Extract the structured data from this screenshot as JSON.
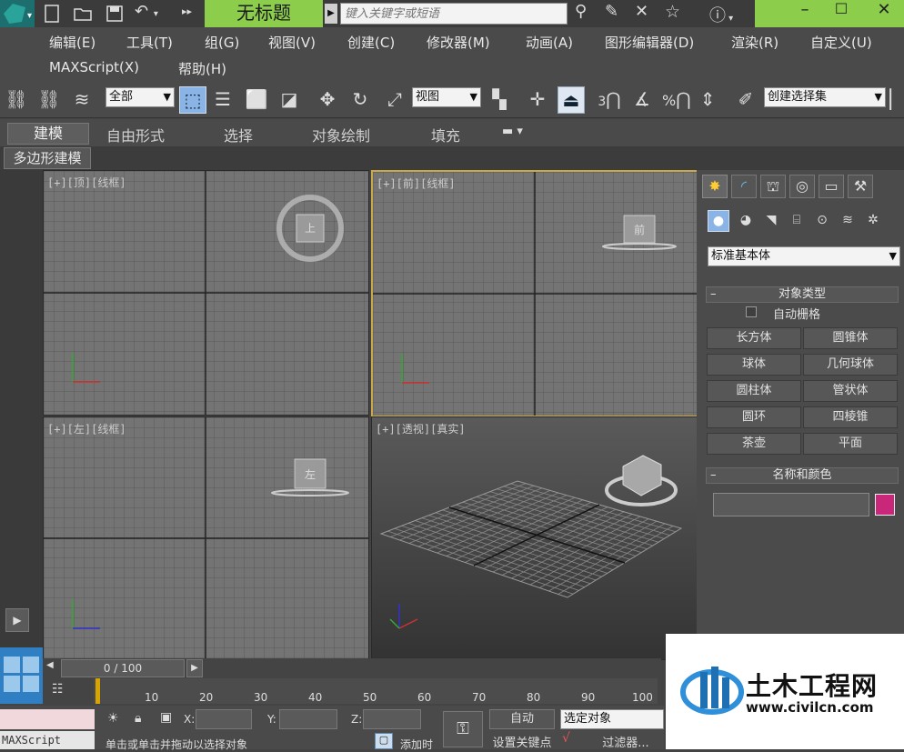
{
  "window": {
    "title": "无标题",
    "search_placeholder": "键入关键字或短语"
  },
  "menu": [
    {
      "label": "编辑(E)"
    },
    {
      "label": "工具(T)"
    },
    {
      "label": "组(G)"
    },
    {
      "label": "视图(V)"
    },
    {
      "label": "创建(C)"
    },
    {
      "label": "修改器(M)"
    },
    {
      "label": "动画(A)"
    },
    {
      "label": "图形编辑器(D)"
    },
    {
      "label": "渲染(R)"
    },
    {
      "label": "自定义(U)"
    },
    {
      "label": "MAXScript(X)"
    },
    {
      "label": "帮助(H)"
    }
  ],
  "toolbar": {
    "selection_filter": "全部",
    "ref_coord": "视图",
    "named_selection": "创建选择集",
    "snap_3": "3",
    "percent": "%"
  },
  "ribbon_tabs": [
    {
      "label": "建模"
    },
    {
      "label": "自由形式"
    },
    {
      "label": "选择"
    },
    {
      "label": "对象绘制"
    },
    {
      "label": "填充"
    }
  ],
  "poly_label": "多边形建模",
  "viewports": {
    "top": {
      "label": "[+][顶][线框]",
      "cube_text": "上"
    },
    "front": {
      "label": "[+][前][线框]",
      "cube_text": "前"
    },
    "left": {
      "label": "[+][左][线框]",
      "cube_text": "左"
    },
    "persp": {
      "label": "[+][透视][真实]"
    }
  },
  "command_panel": {
    "category": "标准基本体",
    "object_type_title": "对象类型",
    "auto_grid": "自动栅格",
    "buttons": [
      "长方体",
      "圆锥体",
      "球体",
      "几何球体",
      "圆柱体",
      "管状体",
      "圆环",
      "四棱锥",
      "茶壶",
      "平面"
    ],
    "name_color_title": "名称和颜色",
    "object_color": "#c8277a"
  },
  "timeline": {
    "frame": "0 / 100",
    "ticks": [
      "10",
      "20",
      "30",
      "40",
      "50",
      "60",
      "70",
      "80",
      "90",
      "100"
    ]
  },
  "status": {
    "maxscript": "MAXScript",
    "message": "单击或单击并拖动以选择对象",
    "x_label": "X:",
    "y_label": "Y:",
    "z_label": "Z:",
    "auto_key": "自动",
    "selected": "选定对象",
    "set_key": "设置关键点",
    "filters": "过滤器...",
    "add_time": "添加时"
  },
  "watermark": {
    "name": "土木工程网",
    "url": "www.civilcn.com"
  }
}
